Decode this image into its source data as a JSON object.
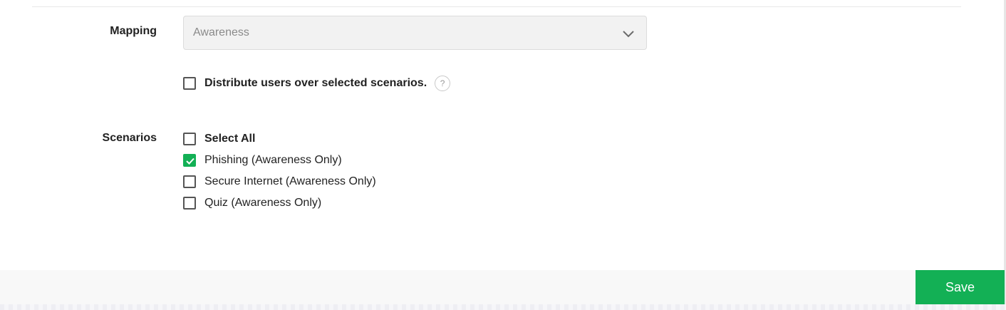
{
  "form": {
    "mapping": {
      "label": "Mapping",
      "selected_value": "Awareness"
    },
    "distribute": {
      "label": "Distribute users over selected scenarios.",
      "checked": false,
      "help_glyph": "?"
    },
    "scenarios": {
      "label": "Scenarios",
      "items": [
        {
          "label": "Select All",
          "checked": false
        },
        {
          "label": "Phishing (Awareness Only)",
          "checked": true
        },
        {
          "label": "Secure Internet (Awareness Only)",
          "checked": false
        },
        {
          "label": "Quiz (Awareness Only)",
          "checked": false
        }
      ]
    }
  },
  "footer": {
    "save_label": "Save"
  },
  "colors": {
    "accent": "#13b055",
    "select_bg": "#f2f2f2",
    "footer_bg": "#f8f8f8"
  },
  "icons": {
    "select": "chevron-down-icon",
    "help": "question-circle-icon",
    "check": "checkmark-icon"
  }
}
